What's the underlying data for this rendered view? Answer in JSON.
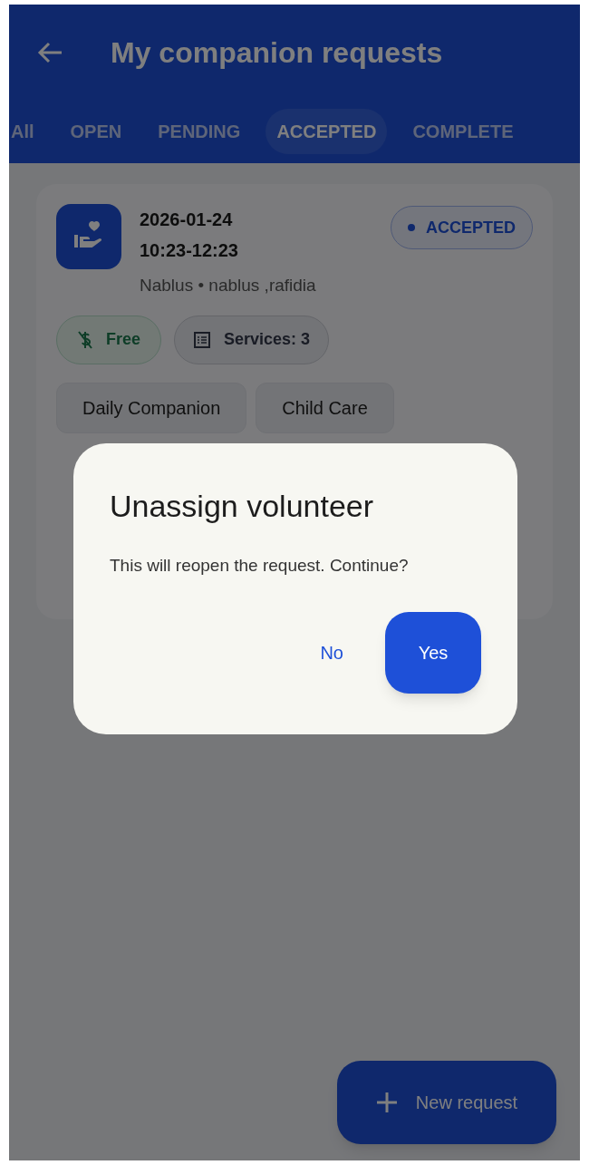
{
  "app_bar": {
    "title": "My companion requests"
  },
  "tabs": [
    {
      "label": "All",
      "selected": false
    },
    {
      "label": "OPEN",
      "selected": false
    },
    {
      "label": "PENDING",
      "selected": false
    },
    {
      "label": "ACCEPTED",
      "selected": true
    },
    {
      "label": "COMPLETE",
      "selected": false
    }
  ],
  "request_card": {
    "date": "2026-01-24",
    "time": "10:23-12:23",
    "location": "Nablus • nablus ,rafidia",
    "status": "ACCEPTED",
    "chips": [
      {
        "kind": "price",
        "label": "Free"
      },
      {
        "kind": "services",
        "label": "Services: 3"
      }
    ],
    "services": [
      "Daily Companion",
      "Child Care"
    ]
  },
  "dialog": {
    "title": "Unassign volunteer",
    "message": "This will reopen the request. Continue?",
    "buttons": [
      {
        "kind": "text",
        "label": "No"
      },
      {
        "kind": "filled",
        "label": "Yes"
      }
    ]
  },
  "fab": {
    "label": "New request"
  }
}
